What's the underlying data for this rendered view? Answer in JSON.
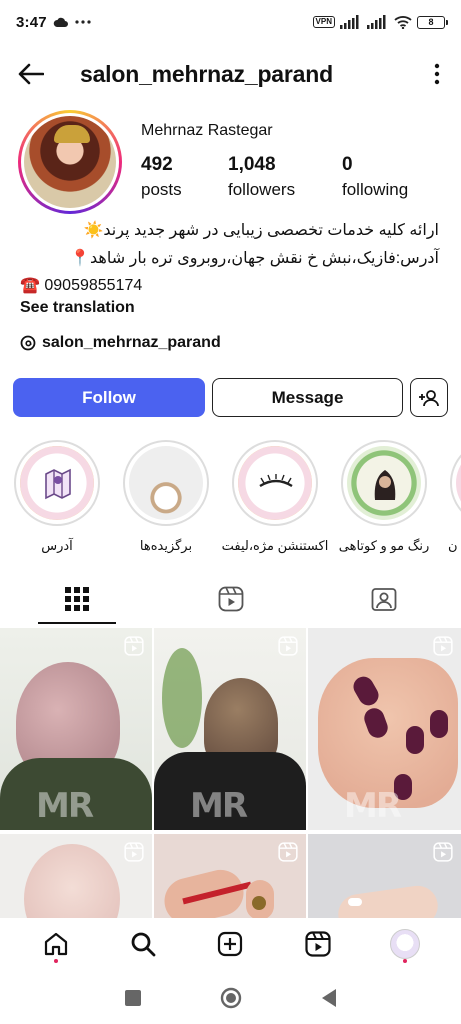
{
  "status_bar": {
    "time": "3:47",
    "vpn_label": "VPN",
    "battery": "8"
  },
  "header": {
    "username": "salon_mehrnaz_parand"
  },
  "profile": {
    "display_name": "Mehrnaz Rastegar",
    "stats": [
      {
        "value": "492",
        "label": "posts"
      },
      {
        "value": "1,048",
        "label": "followers"
      },
      {
        "value": "0",
        "label": "following"
      }
    ],
    "bio": {
      "line1": "ارائه کلیه خدمات تخصصی زیبایی در شهر جدید پرند☀️",
      "line2": "آدرس:فازیک،نبش خ نقش جهان،روبروی تره بار شاهد📍",
      "line3": "☎️ 09059855174",
      "see_translation": "See translation"
    },
    "threads_handle": "salon_mehrnaz_parand"
  },
  "actions": {
    "follow_label": "Follow",
    "message_label": "Message"
  },
  "highlights": [
    {
      "label": "آدرس"
    },
    {
      "label": "برگزیده‌ها"
    },
    {
      "label": "اکستنشن مژه،لیفت"
    },
    {
      "label": "رنگ مو و کوتاهی"
    },
    {
      "label": "ن"
    }
  ],
  "tabs": [
    "posts-grid",
    "reels",
    "tagged"
  ],
  "colors": {
    "follow_button": "#4b62f0",
    "notification_dot": "#e0245e",
    "story_ring_start": "#f9ce34",
    "story_ring_mid": "#ee2a7b"
  },
  "grid_watermark": "MR"
}
